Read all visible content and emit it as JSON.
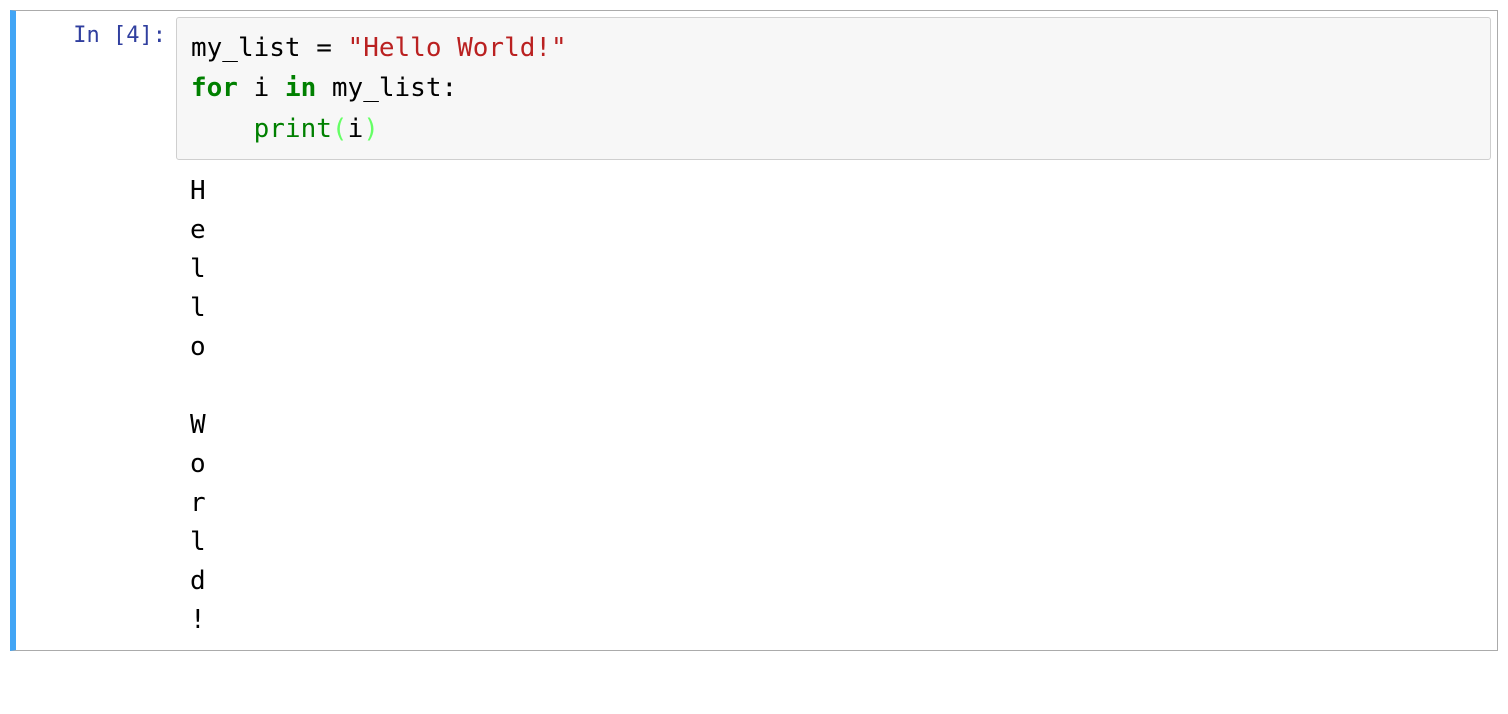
{
  "cell": {
    "prompt_prefix": "In [",
    "execution_count": "4",
    "prompt_suffix": "]:",
    "code": {
      "line1": {
        "var": "my_list",
        "assign": " = ",
        "str": "\"Hello World!\""
      },
      "line2": {
        "kw_for": "for",
        "sp1": " ",
        "iter": "i",
        "sp2": " ",
        "kw_in": "in",
        "sp3": " ",
        "seq": "my_list",
        "colon": ":"
      },
      "line3": {
        "indent": "    ",
        "fn": "print",
        "lparen": "(",
        "arg": "i",
        "rparen": ")"
      }
    },
    "output_lines": [
      "H",
      "e",
      "l",
      "l",
      "o",
      " ",
      "W",
      "o",
      "r",
      "l",
      "d",
      "!"
    ]
  }
}
